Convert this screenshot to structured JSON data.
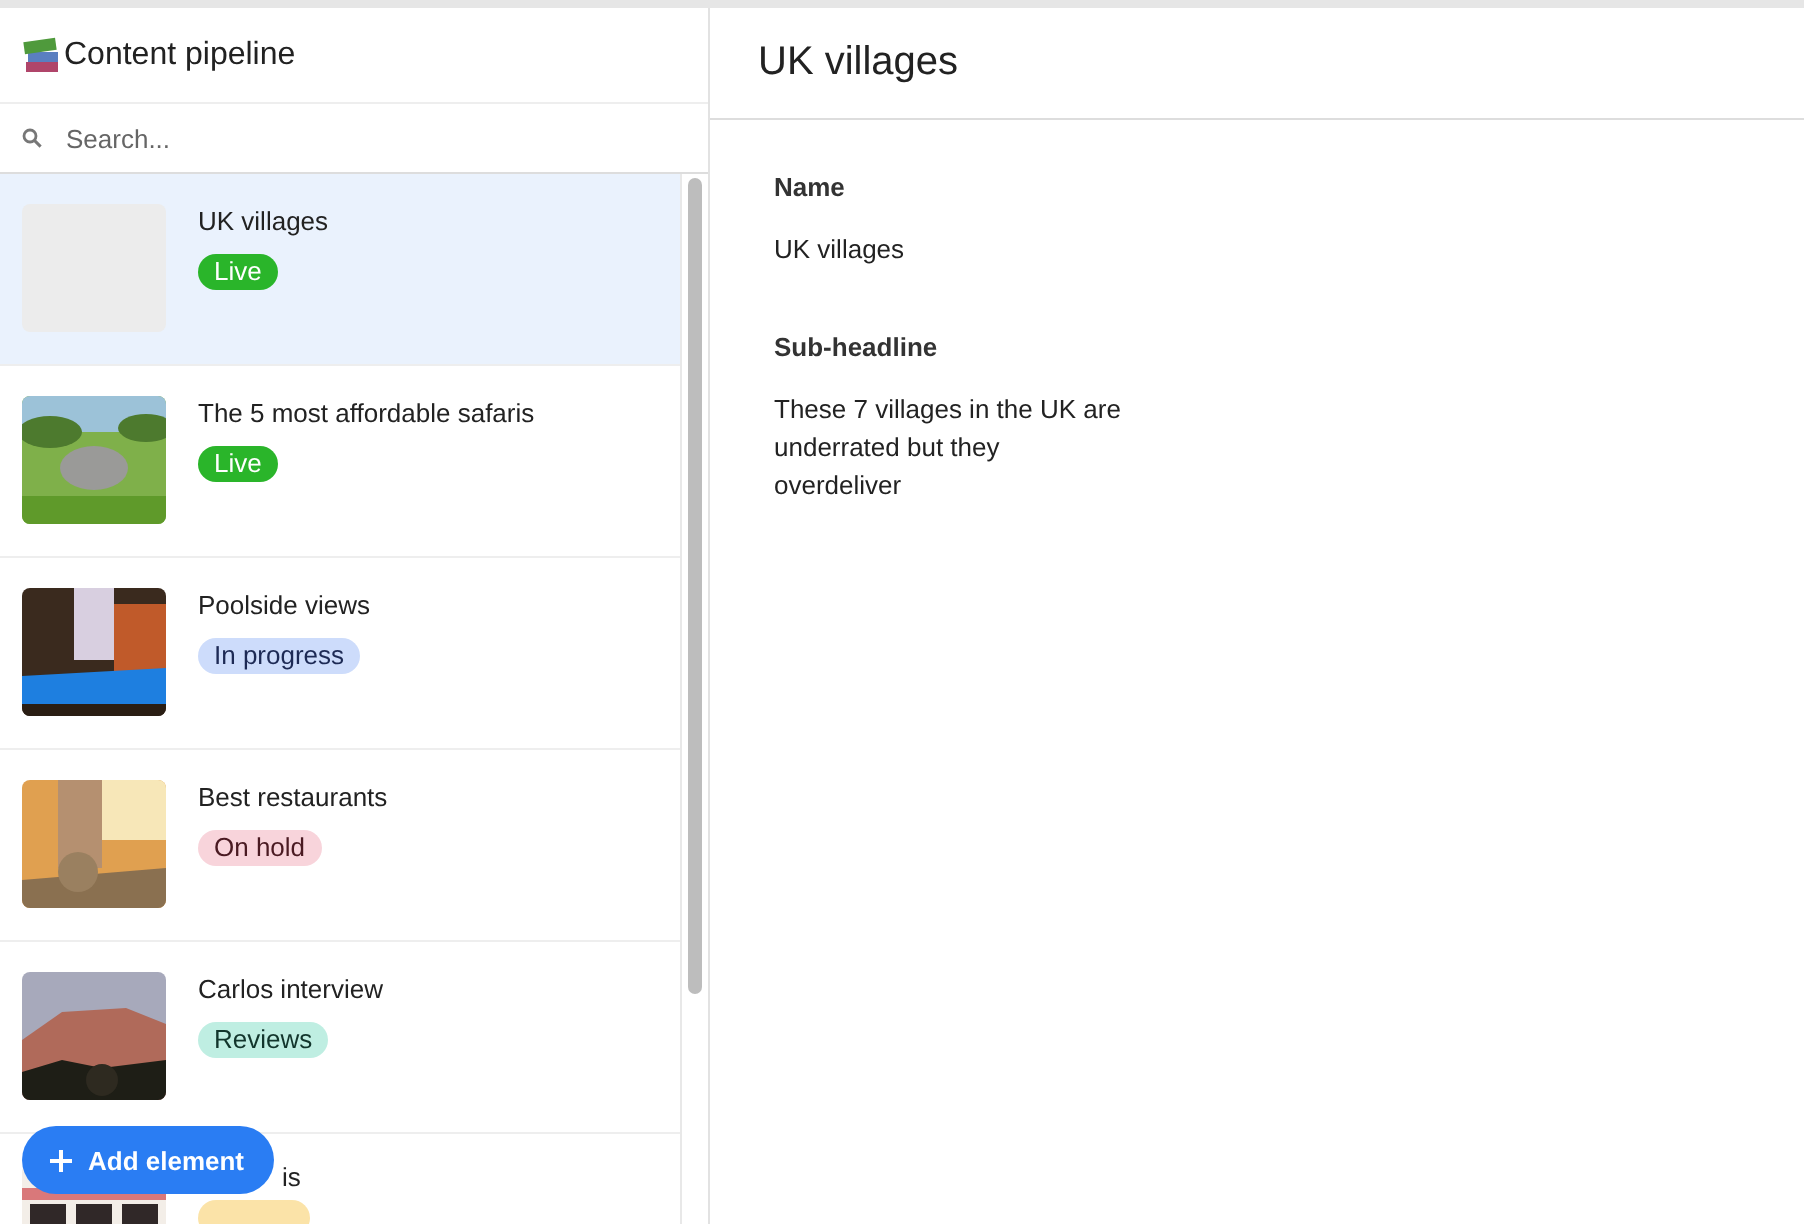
{
  "app": {
    "title": "Content pipeline"
  },
  "search": {
    "placeholder": "Search..."
  },
  "items": [
    {
      "title": "UK villages",
      "status": {
        "kind": "live",
        "label": "Live"
      },
      "thumb": {
        "kind": "placeholder"
      },
      "selected": true,
      "covered": false
    },
    {
      "title": "The 5 most affordable safaris",
      "status": {
        "kind": "live",
        "label": "Live"
      },
      "selected": false,
      "covered": false
    },
    {
      "title": "Poolside views",
      "status": {
        "kind": "progress",
        "label": "In progress"
      },
      "selected": false,
      "covered": false
    },
    {
      "title": "Best restaurants",
      "status": {
        "kind": "hold",
        "label": "On hold"
      },
      "selected": false,
      "covered": false
    },
    {
      "title": "Carlos interview",
      "status": {
        "kind": "reviews",
        "label": "Reviews"
      },
      "selected": false,
      "covered": false
    },
    {
      "title": "is",
      "status": {
        "kind": "draft"
      },
      "selected": false,
      "covered": true
    }
  ],
  "add_button": {
    "label": "Add element"
  },
  "detail": {
    "title": "UK villages",
    "fields": [
      {
        "label": "Name",
        "value": "UK villages"
      },
      {
        "label": "Sub-headline",
        "value": "These 7 villages in the UK are underrated but they overdeliver"
      }
    ]
  }
}
